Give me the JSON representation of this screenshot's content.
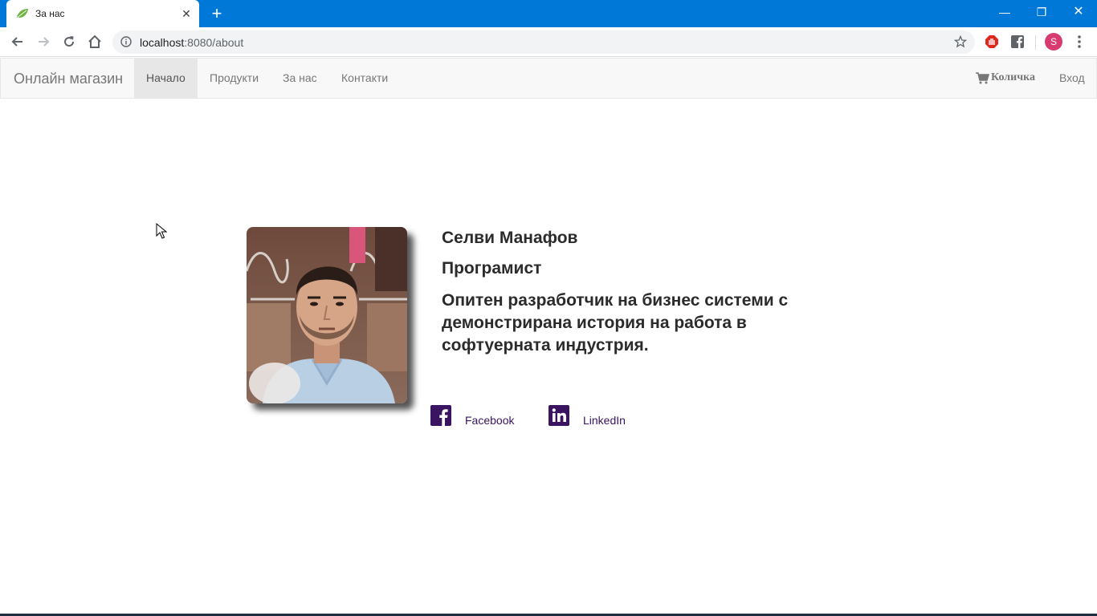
{
  "browser": {
    "tab_title": "За нас",
    "url_host": "localhost",
    "url_rest": ":8080/about",
    "profile_initial": "S"
  },
  "navbar": {
    "brand": "Онлайн магазин",
    "items": [
      {
        "label": "Начало",
        "active": true
      },
      {
        "label": "Продукти",
        "active": false
      },
      {
        "label": "За нас",
        "active": false
      },
      {
        "label": "Контакти",
        "active": false
      }
    ],
    "cart_label": "Количка",
    "login_label": "Вход"
  },
  "profile": {
    "name": "Селви Манафов",
    "role": "Програмист",
    "description": "Опитен разработчик на бизнес системи с демонстрирана история на работа в софтуерната индустрия.",
    "social": [
      {
        "label": "Facebook",
        "icon": "facebook-icon"
      },
      {
        "label": "LinkedIn",
        "icon": "linkedin-icon"
      }
    ]
  },
  "colors": {
    "titlebar": "#0078d7",
    "navbar_bg": "#f8f8f8",
    "social_icon": "#3a1460",
    "heading_text": "#2b2b2b"
  }
}
